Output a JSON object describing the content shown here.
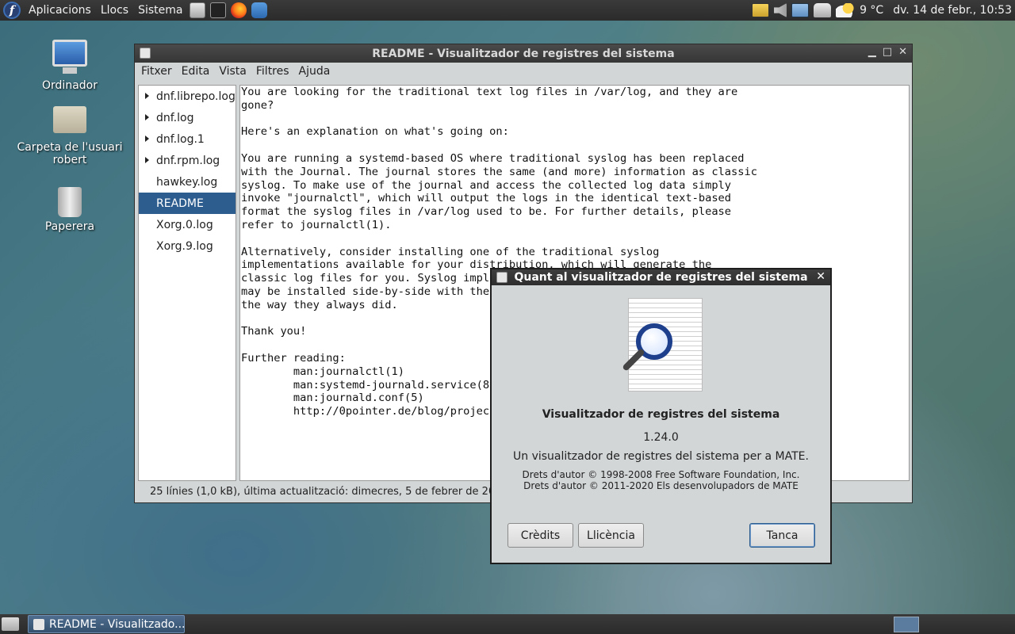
{
  "top_panel": {
    "menus": [
      "Aplicacions",
      "Llocs",
      "Sistema"
    ],
    "temperature": "9 °C",
    "clock": "dv. 14 de febr., 10:53"
  },
  "desktop": {
    "icons": [
      "Ordinador",
      "Carpeta de l'usuari robert",
      "Paperera"
    ]
  },
  "main_window": {
    "title": "README - Visualitzador de registres del sistema",
    "menus": [
      "Fitxer",
      "Edita",
      "Vista",
      "Filtres",
      "Ajuda"
    ],
    "logs": [
      {
        "label": "dnf.librepo.log",
        "expandable": true
      },
      {
        "label": "dnf.log",
        "expandable": true
      },
      {
        "label": "dnf.log.1",
        "expandable": true
      },
      {
        "label": "dnf.rpm.log",
        "expandable": true
      },
      {
        "label": "hawkey.log",
        "expandable": false
      },
      {
        "label": "README",
        "expandable": false,
        "selected": true
      },
      {
        "label": "Xorg.0.log",
        "expandable": false
      },
      {
        "label": "Xorg.9.log",
        "expandable": false
      }
    ],
    "content": "You are looking for the traditional text log files in /var/log, and they are\ngone?\n\nHere's an explanation on what's going on:\n\nYou are running a systemd-based OS where traditional syslog has been replaced\nwith the Journal. The journal stores the same (and more) information as classic\nsyslog. To make use of the journal and access the collected log data simply\ninvoke \"journalctl\", which will output the logs in the identical text-based\nformat the syslog files in /var/log used to be. For further details, please\nrefer to journalctl(1).\n\nAlternatively, consider installing one of the traditional syslog\nimplementations available for your distribution, which will generate the\nclassic log files for you. Syslog implementations such as syslog-ng or rsyslog\nmay be installed side-by-side with the journal and will continue to function\nthe way they always did.\n\nThank you!\n\nFurther reading:\n        man:journalctl(1)\n        man:systemd-journald.service(8)\n        man:journald.conf(5)\n        http://0pointer.de/blog/projects/the-journal.html",
    "status": "25 línies (1,0 kB), última actualització: dimecres, 5 de febrer de 2020, 10:20"
  },
  "about_dialog": {
    "title": "Quant al visualitzador de registres del sistema",
    "program_name": "Visualitzador de registres del sistema",
    "version": "1.24.0",
    "comment": "Un visualitzador de registres del sistema per a MATE.",
    "copyright_1": "Drets d'autor © 1998-2008 Free Software Foundation, Inc.",
    "copyright_2": "Drets d'autor © 2011-2020 Els desenvolupadors de MATE",
    "buttons": {
      "credits": "Crèdits",
      "license": "Llicència",
      "close": "Tanca"
    },
    "close_glyph": "✕"
  },
  "taskbar": {
    "task_label": "README - Visualitzado..."
  },
  "colors": {
    "selection": "#2d5c8e",
    "panel": "#2f2f2f"
  }
}
